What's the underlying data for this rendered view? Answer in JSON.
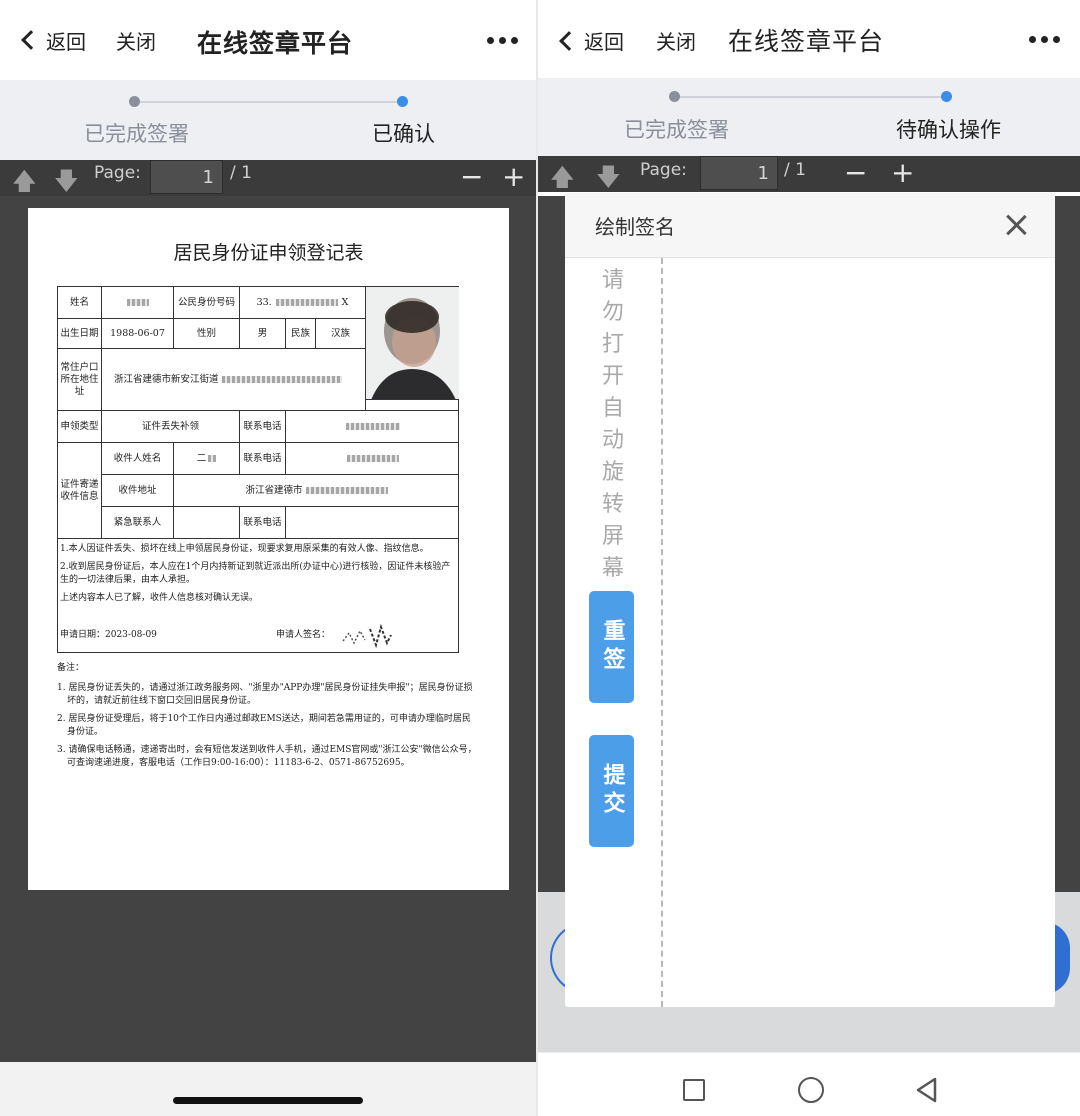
{
  "left": {
    "nav": {
      "back": "返回",
      "close": "关闭",
      "title": "在线签章平台"
    },
    "steps": {
      "step1": "已完成签署",
      "step2": "已确认",
      "inactive_color": "#8a8f99",
      "active_color": "#3b8ee6"
    },
    "toolbar": {
      "page_label": "Page:",
      "page_value": "1",
      "page_total": "/ 1",
      "minus": "−",
      "plus": "+"
    },
    "document": {
      "title": "居民身份证申领登记表",
      "labels": {
        "name": "姓名",
        "id_number": "公民身份号码",
        "id_value": "33.",
        "id_tail": "X",
        "birth": "出生日期",
        "birth_value": "1988-06-07",
        "gender": "性别",
        "gender_value": "男",
        "ethnicity": "民族",
        "ethnicity_value": "汉族",
        "address": "常住户口所在地住址",
        "address_value": "浙江省建德市新安江街道",
        "apply_type": "申领类型",
        "apply_type_value": "证件丢失补领",
        "phone": "联系电话",
        "mail_info": "证件寄递收件信息",
        "recipient": "收件人姓名",
        "recipient_value": "二",
        "phone2": "联系电话",
        "mail_address": "收件地址",
        "mail_address_value": "浙江省建德市",
        "emergency": "紧急联系人",
        "phone3": "联系电话"
      },
      "statements": [
        "1.本人因证件丢失、损坏在线上申领居民身份证，现要求复用原采集的有效人像、指纹信息。",
        "2.收到居民身份证后，本人应在1个月内持新证到就近派出所(办证中心)进行核验，因证件未核验产生的一切法律后果，由本人承担。",
        "上述内容本人已了解，收件人信息核对确认无误。"
      ],
      "apply_date": "申请日期：2023-08-09",
      "signer_label": "申请人签名：",
      "remarks_title": "备注：",
      "remarks": [
        "1. 居民身份证丢失的，请通过浙江政务服务网、\"浙里办\"APP办理\"居民身份证挂失申报\"；居民身份证损坏的，请就近前往线下窗口交回旧居民身份证。",
        "2. 居民身份证受理后，将于10个工作日内通过邮政EMS送达，期间若急需用证的，可申请办理临时居民身份证。",
        "3. 请确保电话畅通，速递寄出时，会有短信发送到收件人手机，通过EMS官网或\"浙江公安\"微信公众号，可查询速递进度，客服电话（工作日9:00-16:00）：11183-6-2、0571-86752695。"
      ]
    }
  },
  "right": {
    "nav": {
      "back": "返回",
      "close": "关闭",
      "title": "在线签章平台"
    },
    "steps": {
      "step1": "已完成签署",
      "step2": "待确认操作"
    },
    "toolbar": {
      "page_label": "Page:",
      "page_value": "1",
      "page_total": "/ 1",
      "minus": "−",
      "plus": "+"
    },
    "modal": {
      "title": "绘制签名",
      "hint": "请勿打开自动旋转屏幕",
      "resign_button": "重签",
      "submit_button": "提交",
      "button_color": "#4d9ee8"
    }
  },
  "icons": [
    "chevron-left-icon",
    "more-icon",
    "arrow-up-icon",
    "arrow-down-icon",
    "close-icon",
    "square-icon",
    "circle-icon",
    "triangle-back-icon"
  ]
}
